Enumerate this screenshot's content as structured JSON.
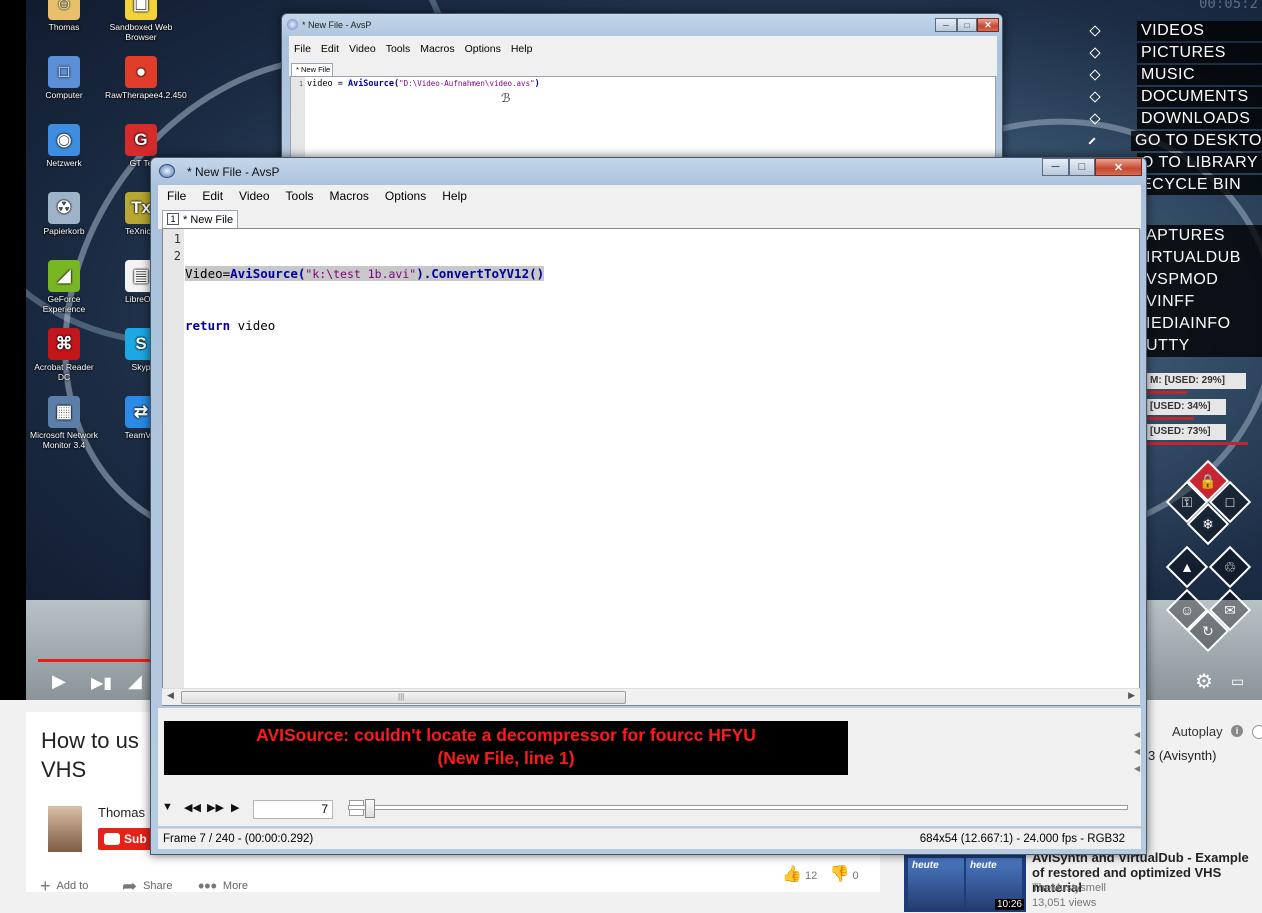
{
  "youtube_player": {
    "timestamp": "00:05:2"
  },
  "desktop_icons": [
    {
      "label": "Thomas",
      "color": "#e6c06a",
      "glyph": "☺"
    },
    {
      "label": "Sandboxed Web Browser",
      "color": "#f2d43a",
      "glyph": "▣"
    },
    {
      "label": "Computer",
      "color": "#5b8fd8",
      "glyph": "□"
    },
    {
      "label": "RawTherapee4.2.450",
      "color": "#e23d2b",
      "glyph": "●"
    },
    {
      "label": "Netzwerk",
      "color": "#3f8de0",
      "glyph": "◉"
    },
    {
      "label": "GT Te",
      "color": "#d52b2b",
      "glyph": "G"
    },
    {
      "label": "Papierkorb",
      "color": "#9fb3c8",
      "glyph": "☢"
    },
    {
      "label": "TeXnicC",
      "color": "#b8a832",
      "glyph": "Tx"
    },
    {
      "label": "GeForce Experience",
      "color": "#79b624",
      "glyph": "◢"
    },
    {
      "label": "LibreOffi",
      "color": "#f4f4f4",
      "glyph": "▤"
    },
    {
      "label": "Acrobat Reader DC",
      "color": "#c3161c",
      "glyph": "⌘"
    },
    {
      "label": "Skyp",
      "color": "#1ba8e3",
      "glyph": "S"
    },
    {
      "label": "Microsoft Network Monitor 3.4",
      "color": "#5c7faa",
      "glyph": "▦"
    },
    {
      "label": "TeamVie",
      "color": "#2b8be6",
      "glyph": "⇄"
    }
  ],
  "desktop_menu": {
    "top": [
      "VIDEOS",
      "PICTURES",
      "MUSIC",
      "DOCUMENTS",
      "DOWNLOADS",
      "GO TO DESKTOP",
      "O TO LIBRARY",
      "ECYCLE BIN"
    ],
    "bottom": [
      "APTURES",
      "IRTUALDUB",
      "VSPMOD",
      "VINFF",
      "IEDIAINFO",
      "UTTY"
    ],
    "meters": [
      "M: [USED: 29%]",
      "[USED: 34%]",
      "[USED: 73%]"
    ],
    "meter_values": [
      29,
      34,
      73
    ]
  },
  "back_window": {
    "title": "* New File - AvsP",
    "menu": [
      "File",
      "Edit",
      "Video",
      "Tools",
      "Macros",
      "Options",
      "Help"
    ],
    "tab": "* New File",
    "line_number": "1",
    "code_prefix": "video = ",
    "code_func": "AviSource(",
    "code_string": "\"D:\\Video-Aufnahmen\\video.avs\"",
    "code_suffix": ")"
  },
  "front_window": {
    "title": "* New File - AvsP",
    "menu": [
      "File",
      "Edit",
      "Video",
      "Tools",
      "Macros",
      "Options",
      "Help"
    ],
    "tab_number": "1",
    "tab": "* New File",
    "line_numbers": [
      "1",
      "2"
    ],
    "line1": {
      "var": "Video=",
      "func": "AviSource(",
      "string": "\"k:\\test 1b.avi\"",
      "close": ")",
      "method": ".ConvertToYV12()"
    },
    "line2": {
      "keyword": "return",
      "rest": " video"
    },
    "error_line1": "AVISource: couldn't locate a decompressor for fourcc HFYU",
    "error_line2": "(New File, line 1)",
    "frame_value": "7",
    "status_left": "Frame 7 / 240  -  (00:00:0.292)",
    "status_right": "684x54 (12.667:1)  -  24.000 fps  -  RGB32"
  },
  "youtube_page": {
    "title": "How to us VHS",
    "title_line1": "How to us",
    "title_line2": "VHS",
    "channel": "Thomas",
    "subscribe": "Sub",
    "add_to": "Add to",
    "share": "Share",
    "more": "More",
    "likes": "12",
    "dislikes": "0",
    "autoplay": "Autoplay",
    "next_up_partial": "3 (Avisynth)",
    "recommended": {
      "title": "AviSynth and VirtualDub - Example of restored and optimized VHS material",
      "channel": "TheMustysmell",
      "views": "13,051 views",
      "duration": "10:26",
      "thumb_label": "heute"
    }
  },
  "colors": {
    "error_text": "#ff1a1a",
    "youtube_red": "#e62117",
    "keyword_blue": "#0000a0",
    "string_purple": "#7f007f"
  }
}
